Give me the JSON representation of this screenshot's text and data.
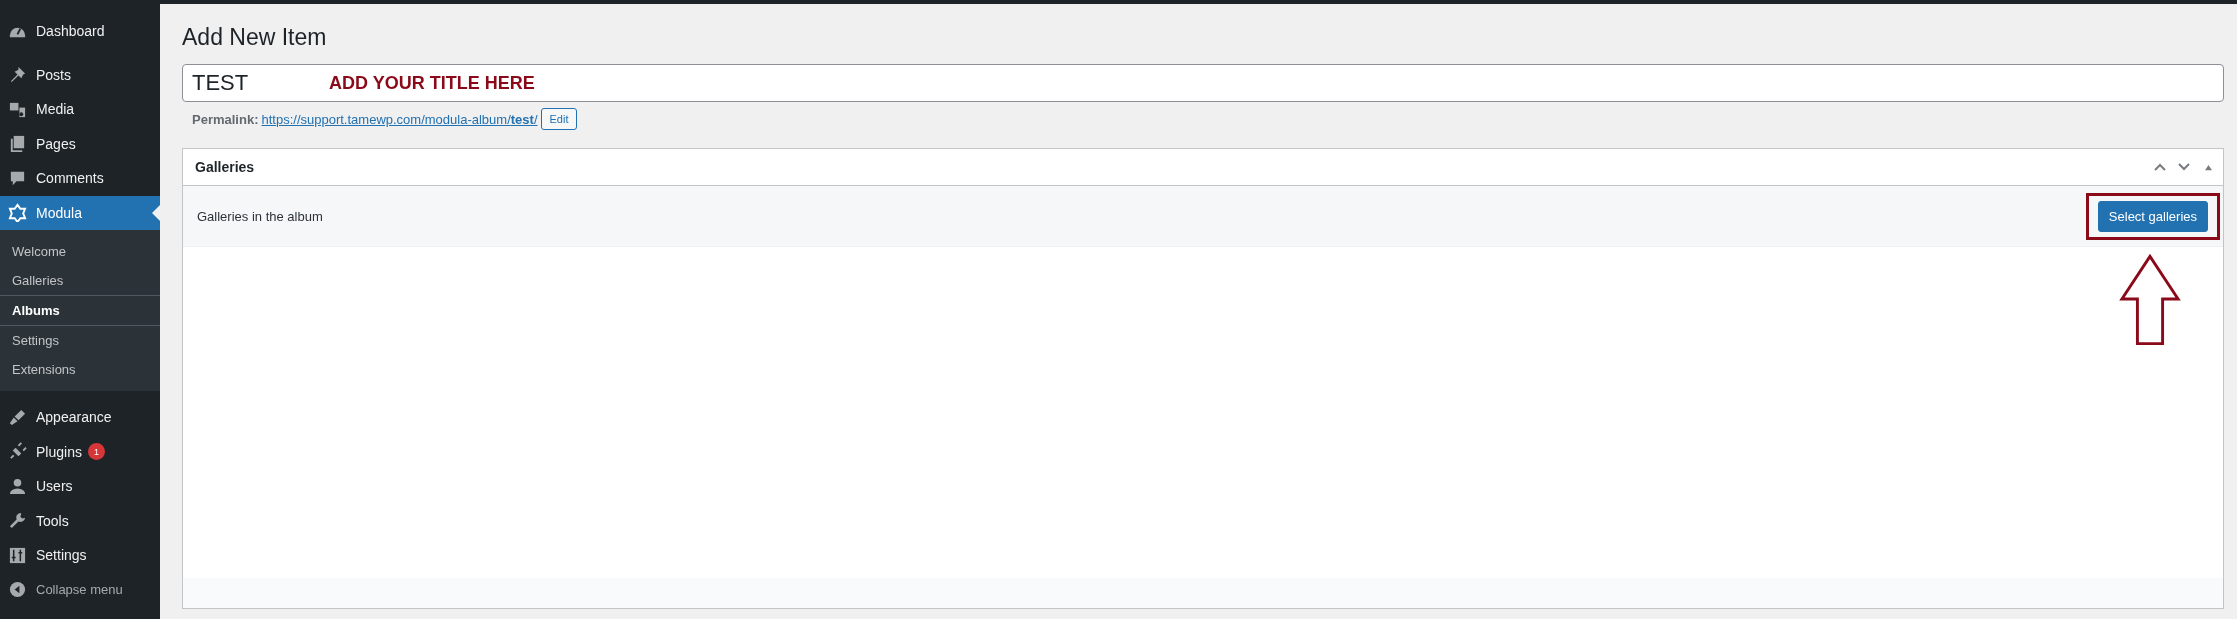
{
  "sidebar": {
    "items": [
      {
        "label": "Dashboard",
        "selected": false
      },
      {
        "label": "Posts",
        "selected": false
      },
      {
        "label": "Media",
        "selected": false
      },
      {
        "label": "Pages",
        "selected": false
      },
      {
        "label": "Comments",
        "selected": false
      },
      {
        "label": "Modula",
        "selected": true,
        "children": [
          {
            "label": "Welcome",
            "selected": false
          },
          {
            "label": "Galleries",
            "selected": false
          },
          {
            "label": "Albums",
            "selected": true
          },
          {
            "label": "Settings",
            "selected": false
          },
          {
            "label": "Extensions",
            "selected": false
          }
        ]
      },
      {
        "label": "Appearance",
        "selected": false
      },
      {
        "label": "Plugins",
        "selected": false,
        "badge": "1"
      },
      {
        "label": "Users",
        "selected": false
      },
      {
        "label": "Tools",
        "selected": false
      },
      {
        "label": "Settings",
        "selected": false
      }
    ],
    "collapse": "Collapse menu"
  },
  "page": {
    "title": "Add New Item",
    "title_field": {
      "value": "TEST"
    },
    "annotation": "ADD YOUR TITLE HERE",
    "permalink": {
      "label": "Permalink:",
      "url": "https://support.tamewp.com/modula-album/**test**/",
      "edit": "Edit"
    }
  },
  "postbox": {
    "title": "Galleries",
    "row_label": "Galleries in the album",
    "button": "Select galleries"
  }
}
